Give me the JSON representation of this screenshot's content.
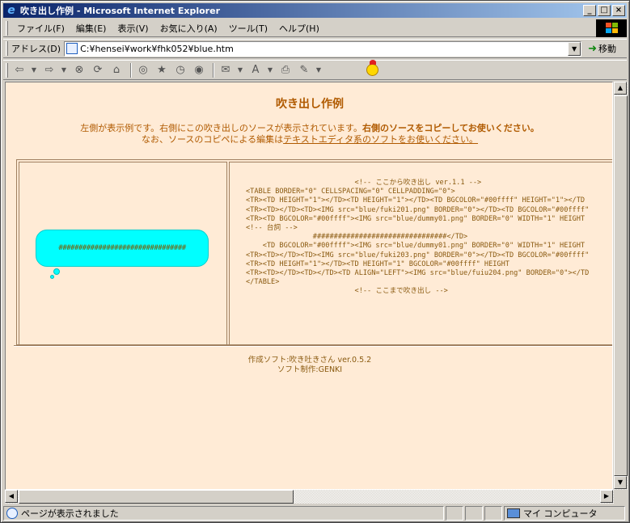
{
  "window": {
    "title": "吹き出し作例 - Microsoft Internet Explorer",
    "controls": {
      "minimize": "_",
      "maximize": "□",
      "close": "×"
    }
  },
  "menu": {
    "items": [
      {
        "label": "ファイル(F)"
      },
      {
        "label": "編集(E)"
      },
      {
        "label": "表示(V)"
      },
      {
        "label": "お気に入り(A)"
      },
      {
        "label": "ツール(T)"
      },
      {
        "label": "ヘルプ(H)"
      }
    ]
  },
  "address": {
    "label": "アドレス(D)",
    "url": "C:¥hensei¥work¥fhk052¥blue.htm",
    "go_label": "移動"
  },
  "toolbar": {
    "icons": [
      "back-icon",
      "forward-icon",
      "stop-icon",
      "refresh-icon",
      "home-icon",
      "search-icon",
      "favorites-icon",
      "history-icon",
      "media-icon",
      "mail-icon",
      "print-icon",
      "edit-icon"
    ]
  },
  "page": {
    "heading": "吹き出し作例",
    "intro_line1_a": "左側が表示例です。右側にこの吹き出しのソースが表示されています。",
    "intro_line1_b": "右側のソースをコピーしてお使いください。",
    "intro_line2_a": "なお、ソースのコピペによる編集は",
    "intro_line2_b": "テキストエディタ系のソフトをお使いください。",
    "bubble_text": "################################",
    "code_lines": [
      "                          <!-- ここから吹き出し ver.1.1 -->",
      "<TABLE BORDER=\"0\" CELLSPACING=\"0\" CELLPADDING=\"0\">",
      "<TR><TD HEIGHT=\"1\"></TD><TD HEIGHT=\"1\"></TD><TD BGCOLOR=\"#00ffff\" HEIGHT=\"1\"></TD",
      "<TR><TD></TD><TD><IMG src=\"blue/fuki201.png\" BORDER=\"0\"></TD><TD BGCOLOR=\"#00ffff\"",
      "<TR><TD BGCOLOR=\"#00ffff\"><IMG src=\"blue/dummy01.png\" BORDER=\"0\" WIDTH=\"1\" HEIGHT",
      "<!-- 台詞 -->",
      "                ################################</TD>",
      "    <TD BGCOLOR=\"#00ffff\"><IMG src=\"blue/dummy01.png\" BORDER=\"0\" WIDTH=\"1\" HEIGHT",
      "<TR><TD></TD><TD><IMG src=\"blue/fuki203.png\" BORDER=\"0\"></TD><TD BGCOLOR=\"#00ffff\"",
      "<TR><TD HEIGHT=\"1\"></TD><TD HEIGHT=\"1\" BGCOLOR=\"#00ffff\" HEIGHT",
      "<TR><TD></TD><TD></TD><TD ALIGN=\"LEFT\"><IMG src=\"blue/fuiu204.png\" BORDER=\"0\"></TD",
      "</TABLE>",
      "                          <!-- ここまで吹き出し -->"
    ],
    "footer_line1": "作成ソフト:吹き吐きさん ver.0.5.2",
    "footer_line2": "ソフト制作:GENKI"
  },
  "status": {
    "text": "ページが表示されました",
    "zone": "マイ コンピュータ"
  },
  "colors": {
    "page_bg": "#ffebd6",
    "accent_text": "#b05a00",
    "bubble": "#00ffff"
  }
}
